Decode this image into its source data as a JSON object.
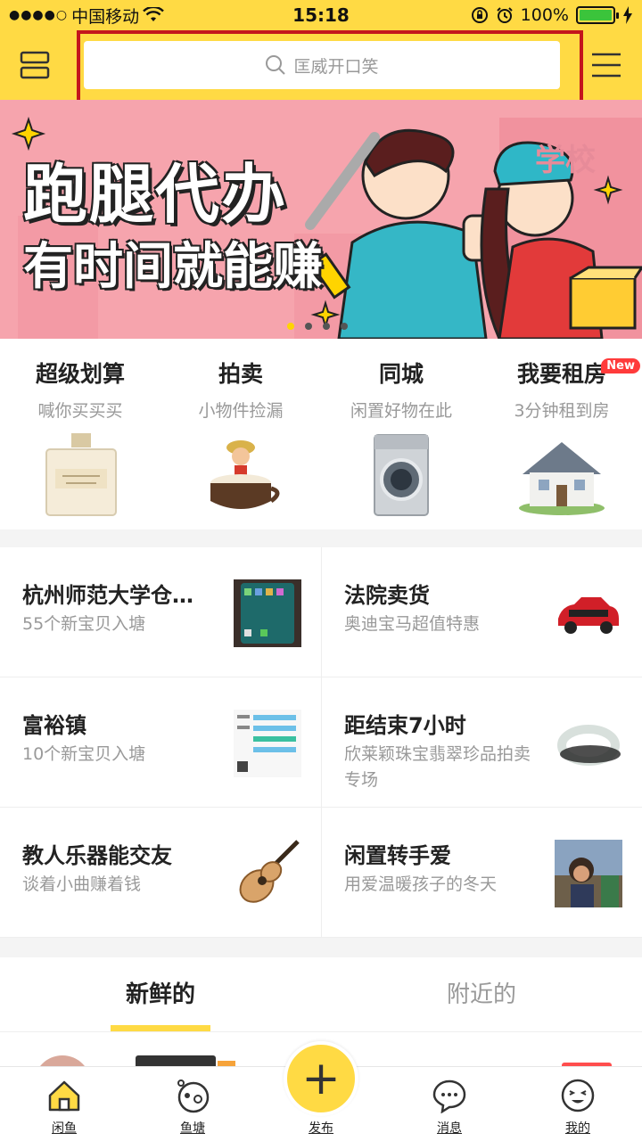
{
  "status_bar": {
    "carrier": "中国移动",
    "signal_dots": "●●●●○",
    "time": "15:18",
    "battery": "100%"
  },
  "header": {
    "search_placeholder": "匡威开口笑"
  },
  "banner": {
    "title": "跑腿代办",
    "subtitle": "有时间就能赚",
    "sign_text": "学校"
  },
  "categories": [
    {
      "title": "超级划算",
      "sub": "喊你买买买",
      "icon": "perfume-bottle"
    },
    {
      "title": "拍卖",
      "sub": "小物件捡漏",
      "icon": "figurine-cup"
    },
    {
      "title": "同城",
      "sub": "闲置好物在此",
      "icon": "washing-machine"
    },
    {
      "title": "我要租房",
      "sub": "3分钟租到房",
      "icon": "house",
      "badge": "New"
    }
  ],
  "cards": [
    {
      "title": "杭州师范大学仓前校区",
      "sub": "55个新宝贝入塘",
      "icon": "phone"
    },
    {
      "title": "法院卖货",
      "sub": "奥迪宝马超值特惠",
      "icon": "red-car"
    },
    {
      "title": "富裕镇",
      "sub": "10个新宝贝入塘",
      "icon": "screenshot"
    },
    {
      "title": "距结束7小时",
      "sub": "欣莱颖珠宝翡翠珍品拍卖专场",
      "icon": "jade-bangle"
    },
    {
      "title": "教人乐器能交友",
      "sub": "谈着小曲赚着钱",
      "icon": "guitar"
    },
    {
      "title": "闲置转手爱",
      "sub": "用爱温暖孩子的冬天",
      "icon": "child-photo"
    }
  ],
  "tabs": [
    {
      "label": "新鲜的",
      "active": true
    },
    {
      "label": "附近的",
      "active": false
    }
  ],
  "bottom_nav": [
    {
      "label": "闲鱼",
      "icon": "home-icon"
    },
    {
      "label": "鱼塘",
      "icon": "fish-pond-icon"
    },
    {
      "label": "发布",
      "icon": "plus-icon"
    },
    {
      "label": "消息",
      "icon": "chat-icon"
    },
    {
      "label": "我的",
      "icon": "face-icon"
    }
  ],
  "publish_symbol": "+",
  "colors": {
    "brand_yellow": "#ffda44",
    "highlight_red": "#c4161c",
    "banner_pink": "#f6a4ad",
    "new_badge": "#ff3b3b"
  }
}
